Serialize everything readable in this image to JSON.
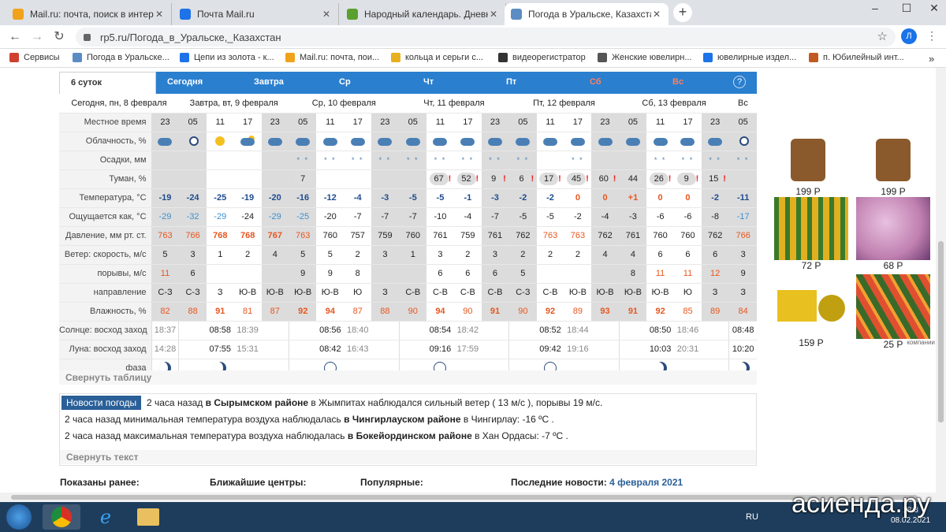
{
  "browser": {
    "tabs": [
      {
        "title": "Mail.ru: почта, поиск в интернет",
        "color": "#f0a21b"
      },
      {
        "title": "Почта Mail.ru",
        "color": "#1e73e8"
      },
      {
        "title": "Народный календарь. Дневник",
        "color": "#5aa02c"
      },
      {
        "title": "Погода в Уральске, Казахстан -",
        "color": "#5c8cc4"
      }
    ],
    "url": "rp5.ru/Погода_в_Уральске,_Казахстан",
    "avatar_letter": "Л",
    "bookmarks": [
      {
        "label": "Сервисы",
        "color": "#d04030"
      },
      {
        "label": "Погода в Уральске...",
        "color": "#5c8cc4"
      },
      {
        "label": "Цепи из золота - к...",
        "color": "#1e73e8"
      },
      {
        "label": "Mail.ru: почта, пои...",
        "color": "#f0a21b"
      },
      {
        "label": "кольца и серьги с...",
        "color": "#e8b020"
      },
      {
        "label": "видеорегистратор",
        "color": "#333333"
      },
      {
        "label": "Женские ювелирн...",
        "color": "#555555"
      },
      {
        "label": "ювелирные издел...",
        "color": "#1e73e8"
      },
      {
        "label": "п. Юбилейный инт...",
        "color": "#c05a20"
      }
    ]
  },
  "forecast": {
    "tabs": [
      {
        "label": "6 суток",
        "style": "first"
      },
      {
        "label": "Сегодня",
        "style": "blue"
      },
      {
        "label": "Завтра",
        "style": "blue"
      },
      {
        "label": "Ср",
        "style": "blue"
      },
      {
        "label": "Чт",
        "style": "blue"
      },
      {
        "label": "Пт",
        "style": "blue"
      },
      {
        "label": "Сб",
        "style": "red"
      },
      {
        "label": "Вс",
        "style": "red"
      }
    ],
    "dates": [
      {
        "label": "Сегодня, пн, 8 февраля",
        "span": 1,
        "red": false
      },
      {
        "label": "Завтра, вт, 9 февраля",
        "span": 4,
        "red": false
      },
      {
        "label": "Ср, 10 февраля",
        "span": 4,
        "red": false
      },
      {
        "label": "Чт, 11 февраля",
        "span": 4,
        "red": false
      },
      {
        "label": "Пт, 12 февраля",
        "span": 4,
        "red": false
      },
      {
        "label": "Сб, 13 февраля",
        "span": 4,
        "red": true
      },
      {
        "label": "Вс",
        "span": 1,
        "red": true
      }
    ],
    "row_labels": {
      "time": "Местное время",
      "cloud": "Облачность, %",
      "precip": "Осадки, мм",
      "fog": "Туман, %",
      "temp": "Температура, °C",
      "feels": "Ощущается как, °C",
      "pressure": "Давление, мм рт. ст.",
      "wind_speed": "Ветер: скорость, м/с",
      "gusts": "порывы, м/с",
      "direction": "направление",
      "humidity": "Влажность, %",
      "sun": "Солнце: восход заход",
      "moon": "Луна: восход заход",
      "phase": "фаза"
    },
    "hours": [
      "23",
      "05",
      "11",
      "17",
      "23",
      "05",
      "11",
      "17",
      "23",
      "05",
      "11",
      "17",
      "23",
      "05",
      "11",
      "17",
      "23",
      "05",
      "11",
      "17",
      "23",
      "05"
    ],
    "night": [
      true,
      true,
      false,
      false,
      true,
      true,
      false,
      false,
      true,
      true,
      false,
      false,
      true,
      true,
      false,
      false,
      true,
      true,
      false,
      false,
      true,
      true
    ],
    "cloud_icons": [
      "cloud",
      "moon",
      "sun",
      "sun-cloud",
      "cloud",
      "cloud",
      "cloud",
      "cloud",
      "cloud",
      "cloud",
      "cloud",
      "cloud",
      "cloud",
      "cloud",
      "cloud",
      "cloud",
      "cloud",
      "cloud",
      "cloud",
      "cloud",
      "cloud",
      "moon"
    ],
    "precip": [
      "",
      "",
      "",
      "",
      "",
      "* *",
      "* *",
      "* *",
      "* *",
      "* *",
      "* *",
      "* *",
      "* *",
      "* *",
      "",
      "* *",
      "",
      "",
      "* *",
      "* *",
      "* *",
      "* *"
    ],
    "fog": [
      "",
      "",
      "",
      "",
      "",
      "7",
      "",
      "",
      "",
      "",
      "67",
      "52",
      "9",
      "6",
      "17",
      "45",
      "60",
      "44",
      "26",
      "9",
      "15",
      ""
    ],
    "fog_alert": [
      false,
      false,
      false,
      false,
      false,
      false,
      false,
      false,
      false,
      false,
      true,
      true,
      true,
      true,
      true,
      true,
      true,
      false,
      true,
      true,
      true,
      false
    ],
    "temp": [
      "-19",
      "-24",
      "-25",
      "-19",
      "-20",
      "-16",
      "-12",
      "-4",
      "-3",
      "-5",
      "-5",
      "-1",
      "-3",
      "-2",
      "-2",
      "0",
      "0",
      "+1",
      "0",
      "0",
      "-2",
      "-11"
    ],
    "temp_style": [
      "b",
      "b",
      "b",
      "b",
      "b",
      "b",
      "b",
      "b",
      "b",
      "b",
      "b",
      "b",
      "b",
      "b",
      "b",
      "r",
      "r",
      "r",
      "r",
      "r",
      "b",
      "b"
    ],
    "feels": [
      "-29",
      "-32",
      "-29",
      "-24",
      "-29",
      "-25",
      "-20",
      "-7",
      "-7",
      "-7",
      "-10",
      "-4",
      "-7",
      "-5",
      "-5",
      "-2",
      "-4",
      "-3",
      "-6",
      "-6",
      "-8",
      "-17"
    ],
    "feels_light": [
      true,
      true,
      true,
      false,
      true,
      true,
      false,
      false,
      false,
      false,
      false,
      false,
      false,
      false,
      false,
      false,
      false,
      false,
      false,
      false,
      false,
      true
    ],
    "pressure": [
      "763",
      "766",
      "768",
      "768",
      "767",
      "763",
      "760",
      "757",
      "759",
      "760",
      "761",
      "759",
      "761",
      "762",
      "763",
      "763",
      "762",
      "761",
      "760",
      "760",
      "762",
      "766"
    ],
    "pressure_style": [
      "o",
      "o",
      "ob",
      "ob",
      "ob",
      "o",
      "",
      "",
      "",
      "",
      "",
      "",
      "",
      "",
      "o",
      "o",
      "",
      "",
      "",
      "",
      "",
      "o"
    ],
    "wind_speed": [
      "5",
      "3",
      "1",
      "2",
      "4",
      "5",
      "5",
      "2",
      "3",
      "1",
      "3",
      "2",
      "3",
      "2",
      "2",
      "2",
      "4",
      "4",
      "6",
      "6",
      "6",
      "3"
    ],
    "gusts": [
      "11",
      "6",
      "",
      "",
      "",
      "9",
      "9",
      "8",
      "",
      "",
      "6",
      "6",
      "6",
      "5",
      "",
      "",
      "",
      "8",
      "11",
      "11",
      "12",
      "9"
    ],
    "direction": [
      "С-З",
      "С-З",
      "З",
      "Ю-В",
      "Ю-В",
      "Ю-В",
      "Ю-В",
      "Ю",
      "З",
      "С-В",
      "С-В",
      "С-В",
      "С-В",
      "С-З",
      "С-В",
      "Ю-В",
      "Ю-В",
      "Ю-В",
      "Ю-В",
      "Ю",
      "З",
      "З"
    ],
    "humidity": [
      "82",
      "88",
      "91",
      "81",
      "87",
      "92",
      "94",
      "87",
      "88",
      "90",
      "94",
      "90",
      "91",
      "90",
      "92",
      "89",
      "93",
      "91",
      "92",
      "85",
      "89",
      "84"
    ],
    "humidity_bold": [
      false,
      false,
      true,
      false,
      false,
      true,
      true,
      false,
      false,
      false,
      true,
      false,
      true,
      false,
      true,
      false,
      true,
      true,
      true,
      false,
      false,
      false
    ],
    "sun": [
      {
        "rise": "18:37",
        "set": ""
      },
      {
        "rise": "08:58",
        "set": "18:39"
      },
      {
        "rise": "08:56",
        "set": "18:40"
      },
      {
        "rise": "08:54",
        "set": "18:42"
      },
      {
        "rise": "08:52",
        "set": "18:44"
      },
      {
        "rise": "08:50",
        "set": "18:46"
      },
      {
        "rise": "08:48",
        "set": ""
      }
    ],
    "moon": [
      {
        "rise": "14:28",
        "set": ""
      },
      {
        "rise": "07:55",
        "set": "15:31"
      },
      {
        "rise": "08:42",
        "set": "16:43"
      },
      {
        "rise": "09:16",
        "set": "17:59"
      },
      {
        "rise": "09:42",
        "set": "19:16"
      },
      {
        "rise": "10:03",
        "set": "20:31"
      },
      {
        "rise": "10:20",
        "set": ""
      }
    ],
    "phases": [
      "crescent",
      "crescent",
      "new",
      "new",
      "new",
      "waxing",
      "waxing"
    ],
    "collapse_table": "Свернуть таблицу"
  },
  "news": {
    "header": "Новости погоды",
    "line1": {
      "pre": "2 часа назад ",
      "bold": "в Сырымском районе",
      "post": " в Жымпитах наблюдался сильный ветер ( 13 м/с ), порывы 19 м/с."
    },
    "line2": {
      "pre": "2 часа назад минимальная температура воздуха наблюдалась ",
      "bold": "в Чингирлауском районе",
      "post": " в Чингирлау: -16 ºC ."
    },
    "line3": {
      "pre": "2 часа назад максимальная температура воздуха наблюдалась ",
      "bold": "в Бокейординском районе",
      "post": " в Хан Ордасы: -7 ºC ."
    },
    "collapse_text": "Свернуть текст"
  },
  "footer": {
    "shown": "Показаны ранее:",
    "nearby": "Ближайшие центры:",
    "popular": "Популярные:",
    "latest": "Последние новости:",
    "latest_date": "4 февраля 2021"
  },
  "ads": [
    {
      "price": "199 Р",
      "color": "#8a5a2c"
    },
    {
      "price": "199 Р",
      "color": "#8a5a2c"
    },
    {
      "price": "72 Р",
      "color": "#e0b020"
    },
    {
      "price": "68 Р",
      "color": "#c080b0"
    },
    {
      "price": "159 Р",
      "color": "#e8c020"
    },
    {
      "price": "25 Р",
      "color": "#e05030"
    }
  ],
  "ads_label": "компании",
  "taskbar": {
    "lang": "RU",
    "time": "18:3",
    "date": "08.02.2021"
  },
  "watermark": "асиенда.ру"
}
